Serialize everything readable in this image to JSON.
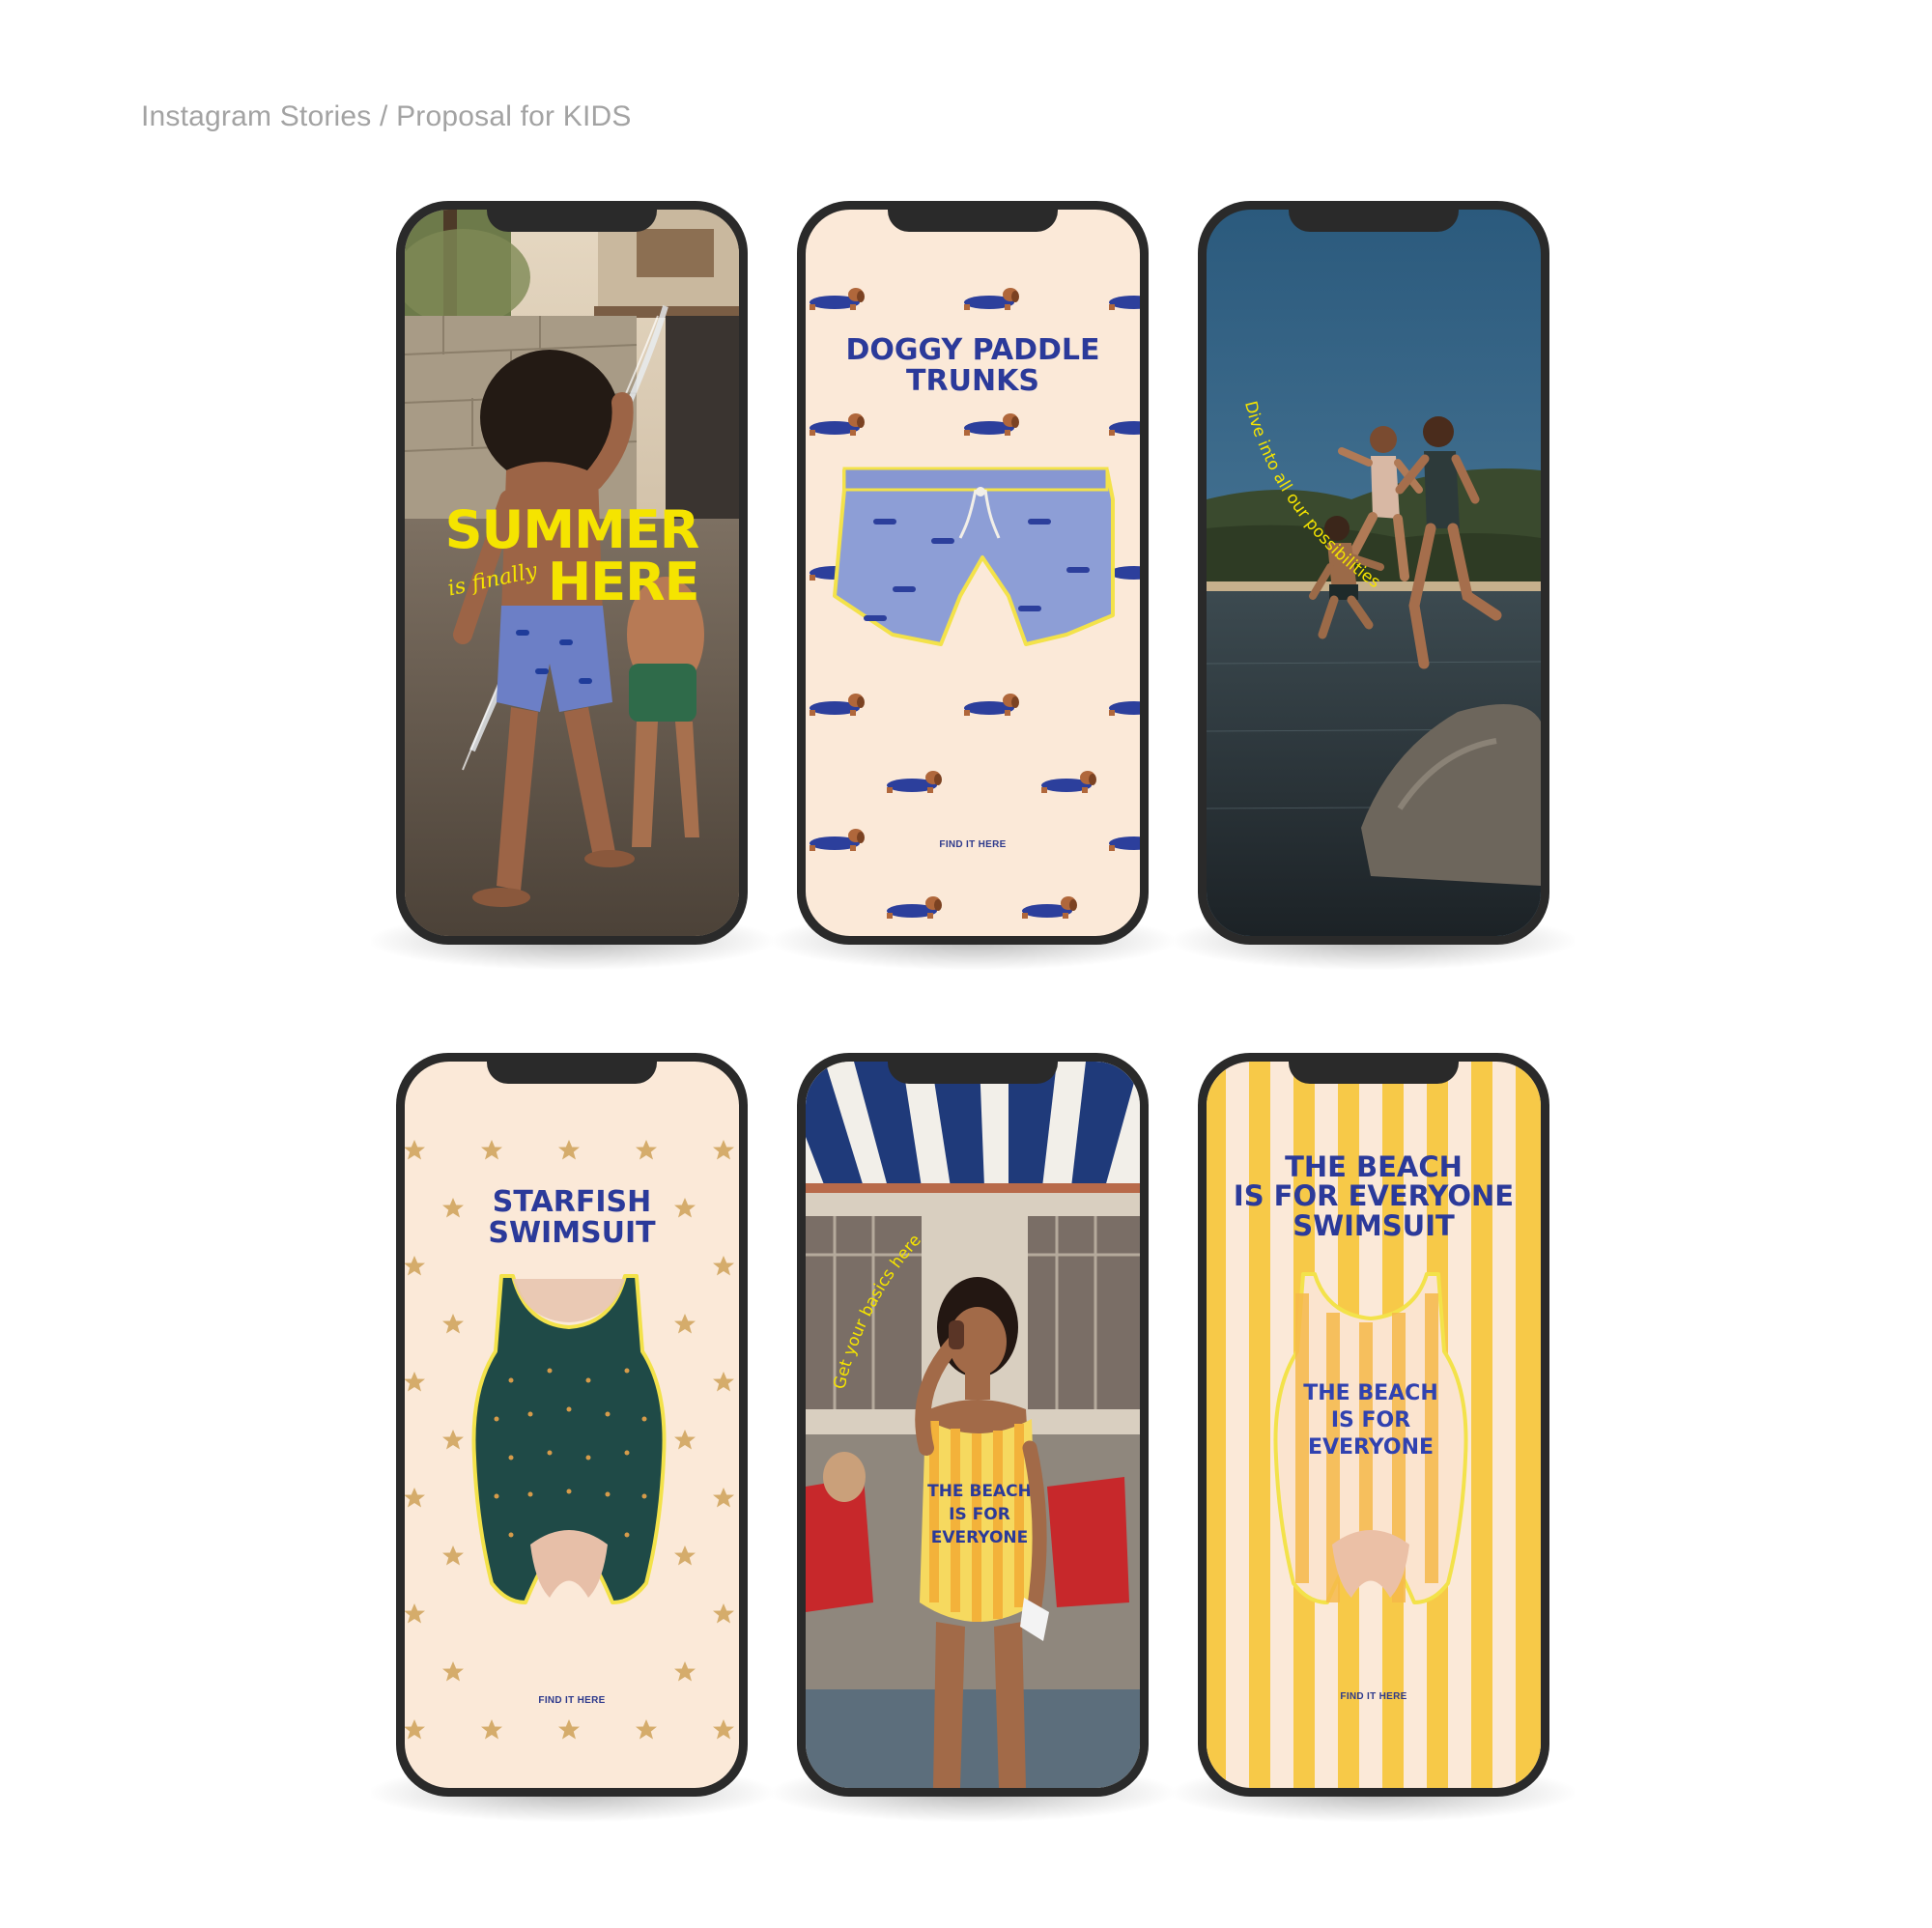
{
  "page_title": "Instagram Stories / Proposal for KIDS",
  "colors": {
    "accent_yellow": "#f5e400",
    "title_blue": "#2b3a9a",
    "cream": "#fbe9d8",
    "phone_frame": "#2a2a2a",
    "stripe_yellow": "#f7c948"
  },
  "stories": {
    "summer": {
      "line1": "SUMMER",
      "script": "is finally",
      "line2": "HERE"
    },
    "doggy": {
      "title": "DOGGY PADDLE\nTRUNKS",
      "cta": "FIND IT HERE",
      "pattern_icon": "dachshund-swimming-icon"
    },
    "dive": {
      "curved_text": "Dive into all our possibilities"
    },
    "starfish": {
      "title": "STARFISH\nSWIMSUIT",
      "cta": "FIND IT HERE",
      "pattern_icon": "star-icon"
    },
    "basics": {
      "curved_text": "Get your basics here",
      "swimsuit_print": "THE BEACH\nIS FOR\nEVERYONE"
    },
    "beach": {
      "title": "THE BEACH\nIS FOR EVERYONE\nSWIMSUIT",
      "swimsuit_print": "THE BEACH\nIS FOR\nEVERYONE",
      "cta": "FIND IT HERE"
    }
  }
}
